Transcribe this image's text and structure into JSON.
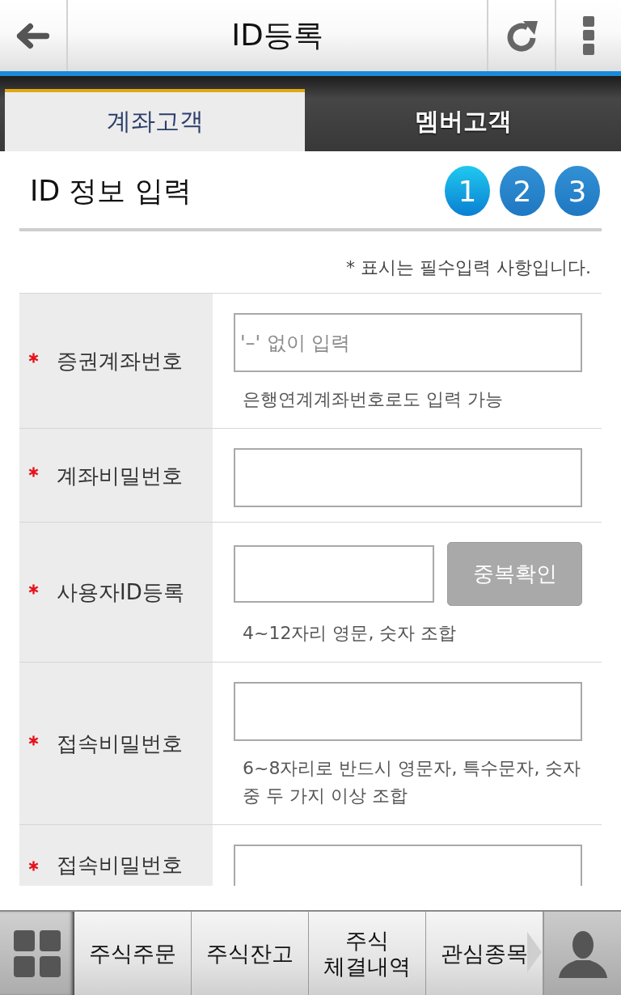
{
  "header": {
    "title": "ID등록"
  },
  "tabs": [
    {
      "label": "계좌고객",
      "selected": true
    },
    {
      "label": "멤버고객",
      "selected": false
    }
  ],
  "section": {
    "title": "ID 정보 입력",
    "steps": [
      {
        "label": "1",
        "selected": true
      },
      {
        "label": "2",
        "selected": false
      },
      {
        "label": "3",
        "selected": false
      }
    ],
    "note": "* 표시는 필수입력 사항입니다."
  },
  "form_rows": [
    {
      "label": "증권계좌번호",
      "required": true,
      "kind": "text",
      "placeholder": "'–' 없이 입력",
      "help": "은행연계계좌번호로도 입력 가능"
    },
    {
      "label": "계좌비밀번호",
      "required": true,
      "kind": "text"
    },
    {
      "label": "사용자ID등록",
      "required": true,
      "kind": "text_button",
      "button": "중복확인",
      "help": "4~12자리 영문, 숫자 조합"
    },
    {
      "label": "접속비밀번호",
      "required": true,
      "kind": "text",
      "help": "6~8자리로 반드시 영문자, 특수문자, 숫자 중 두 가지 이상 조합"
    },
    {
      "label": "접속비밀번호",
      "required": true,
      "kind": "text"
    }
  ],
  "bottom_nav": {
    "items": [
      {
        "label": "주식주문"
      },
      {
        "label": "주식잔고"
      },
      {
        "label": "주식\n체결내역"
      },
      {
        "label": "관심종목"
      }
    ]
  }
}
